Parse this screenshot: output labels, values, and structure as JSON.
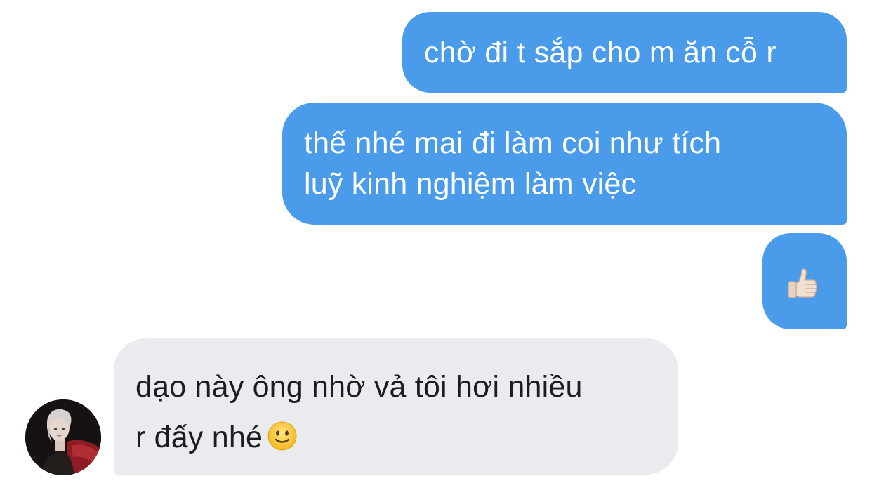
{
  "conversation": {
    "messages": [
      {
        "direction": "sent",
        "text": "chờ đi t sắp cho m ăn cỗ r"
      },
      {
        "direction": "sent",
        "text": "thế nhé mai đi làm coi như tích\nluỹ kinh nghiệm làm việc"
      },
      {
        "direction": "sent",
        "emoji": "thumbs-up"
      },
      {
        "direction": "received",
        "text": "dạo này ông nhờ vả tôi hơi nhiều\nr đấy nhé",
        "trailing_emoji": "slightly-smiling-face"
      }
    ]
  },
  "colors": {
    "sent_bubble": "#4a9ceb",
    "received_bubble": "#e9ebef",
    "sent_text": "#ffffff",
    "received_text": "#1d1d1f"
  },
  "icons": {
    "thumbs_up": "thumbs-up-icon",
    "smile": "slightly-smiling-face-icon",
    "avatar": "contact-avatar"
  }
}
